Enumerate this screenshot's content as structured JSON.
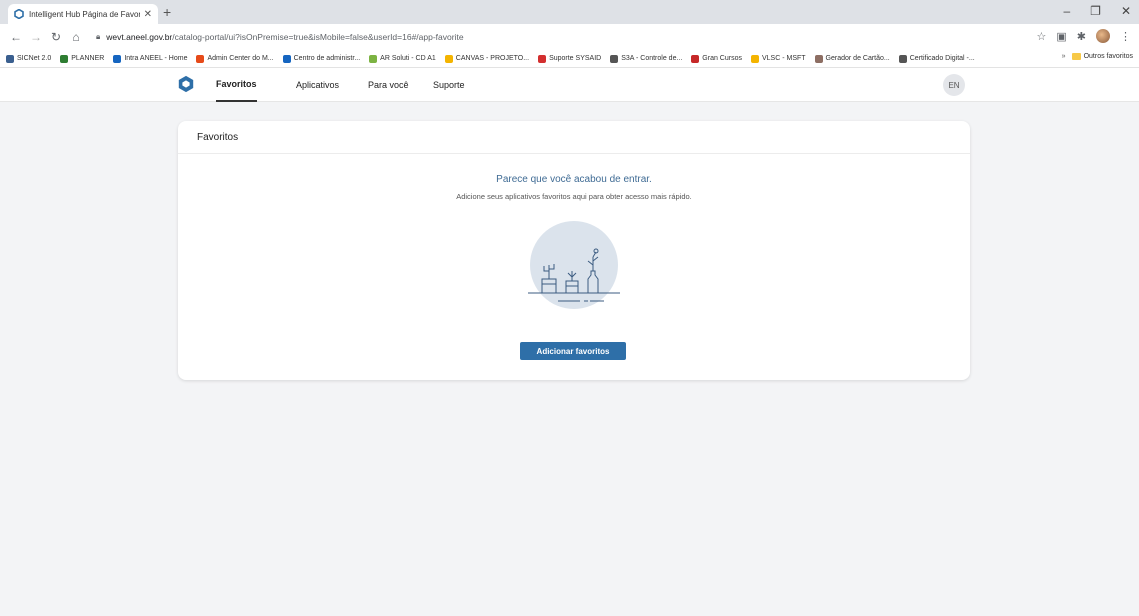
{
  "browser": {
    "tab_title": "Intelligent Hub Página de Favorit",
    "url_domain": "wevt.aneel.gov.br",
    "url_path": "/catalog-portal/ui?isOnPremise=true&isMobile=false&userId=16#/app-favorite",
    "bookmarks": [
      {
        "label": "SICNet 2.0",
        "color": "#3a5f8f"
      },
      {
        "label": "PLANNER",
        "color": "#2e7d32"
      },
      {
        "label": "Intra ANEEL - Home",
        "color": "#1565c0"
      },
      {
        "label": "Admin Center do M...",
        "color": "#e64a19"
      },
      {
        "label": "Centro de administr...",
        "color": "#1565c0"
      },
      {
        "label": "AR Soluti - CD A1",
        "color": "#7cb342"
      },
      {
        "label": "CANVAS - PROJETO...",
        "color": "#f4b400"
      },
      {
        "label": "Suporte SYSAID",
        "color": "#d32f2f"
      },
      {
        "label": "S3A - Controle de...",
        "color": "#555555"
      },
      {
        "label": "Gran Cursos",
        "color": "#c62828"
      },
      {
        "label": "VLSC - MSFT",
        "color": "#f4b400"
      },
      {
        "label": "Gerador de Cartão...",
        "color": "#8d6e63"
      },
      {
        "label": "Certificado Digital -...",
        "color": "#555555"
      }
    ],
    "more_bookmarks": "»",
    "other_favorites": "Outros favoritos"
  },
  "app": {
    "nav": [
      {
        "label": "Favoritos",
        "active": true
      },
      {
        "label": "Aplicativos",
        "active": false
      },
      {
        "label": "Para você",
        "active": false
      },
      {
        "label": "Suporte",
        "active": false
      }
    ],
    "user_initials": "EN"
  },
  "card": {
    "title": "Favoritos",
    "empty_title": "Parece que você acabou de entrar.",
    "empty_desc": "Adicione seus aplicativos favoritos aqui para obter acesso mais rápido.",
    "button_label": "Adicionar favoritos"
  },
  "colors": {
    "accent": "#2e6fa8",
    "empty_title": "#3f6b94",
    "background": "#f3f4f6"
  }
}
